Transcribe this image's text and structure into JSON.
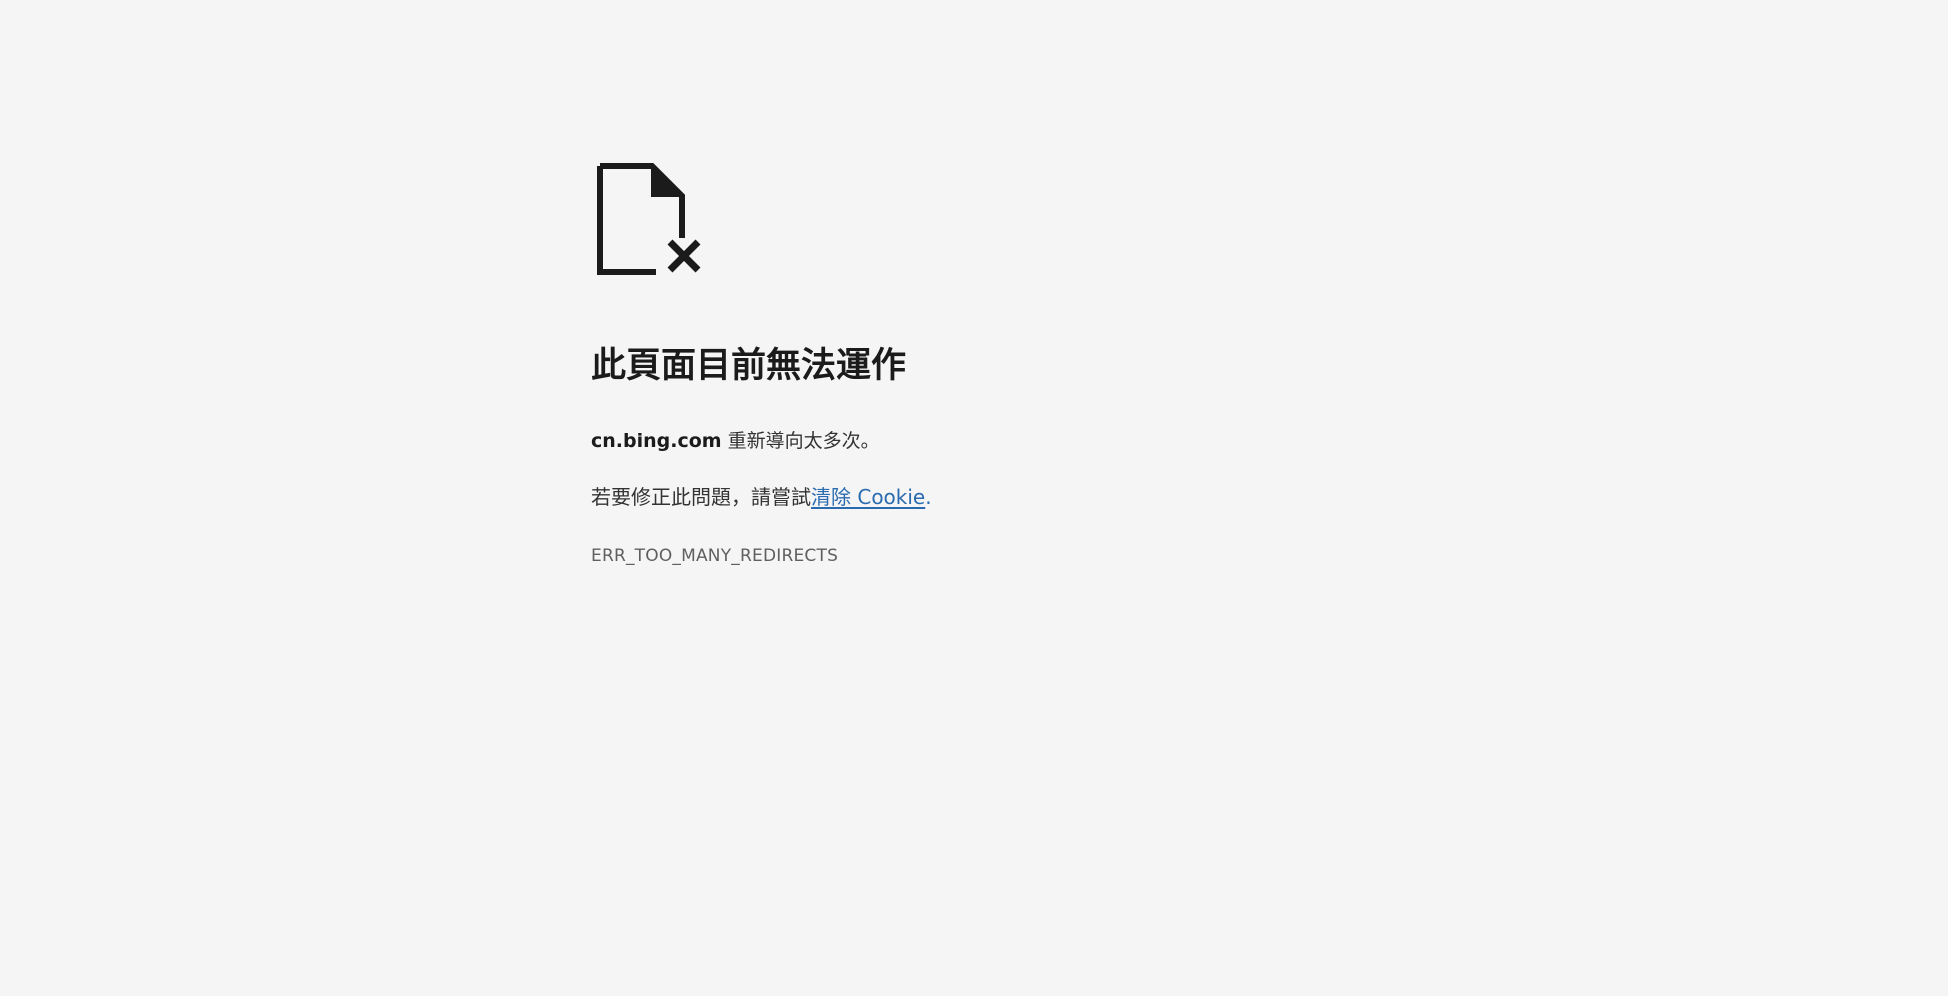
{
  "icon": "page-broken-icon",
  "title": "此頁面目前無法運作",
  "host_line": {
    "host": "cn.bing.com",
    "message": " 重新導向太多次。"
  },
  "fix_line": {
    "prefix": "若要修正此問題，請嘗試",
    "link_label": "清除 Cookie",
    "suffix": "."
  },
  "error_code": "ERR_TOO_MANY_REDIRECTS",
  "colors": {
    "background": "#f5f5f5",
    "text": "#1b1b1b",
    "link": "#2a6bb0",
    "code": "#5f5f5f"
  }
}
